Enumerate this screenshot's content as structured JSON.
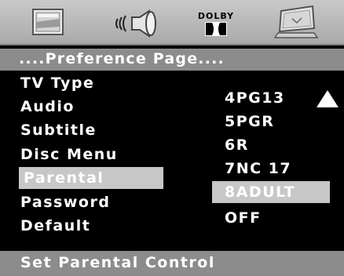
{
  "icons": [
    "tv-setup-icon",
    "audio-icon",
    "dolby-icon",
    "display-icon"
  ],
  "dolby": {
    "label": "DOLBY"
  },
  "title": "....Preference Page....",
  "menu": {
    "items": [
      {
        "label": "TV Type"
      },
      {
        "label": "Audio"
      },
      {
        "label": "Subtitle"
      },
      {
        "label": "Disc Menu"
      },
      {
        "label": "Parental"
      },
      {
        "label": "Password"
      },
      {
        "label": "Default"
      }
    ],
    "selected": "Parental"
  },
  "options": {
    "items": [
      {
        "label": "4PG13"
      },
      {
        "label": "5PGR"
      },
      {
        "label": "6R"
      },
      {
        "label": "7NC 17"
      },
      {
        "label": "8ADULT"
      },
      {
        "label": "OFF"
      }
    ],
    "selected": "8ADULT",
    "scroll_indicator": "up-arrow-icon"
  },
  "status": "Set Parental Control",
  "colors": {
    "background": "#000000",
    "bar_gray": "#8c8c8c",
    "highlight": "#c7c7c7",
    "text": "#ffffff"
  }
}
